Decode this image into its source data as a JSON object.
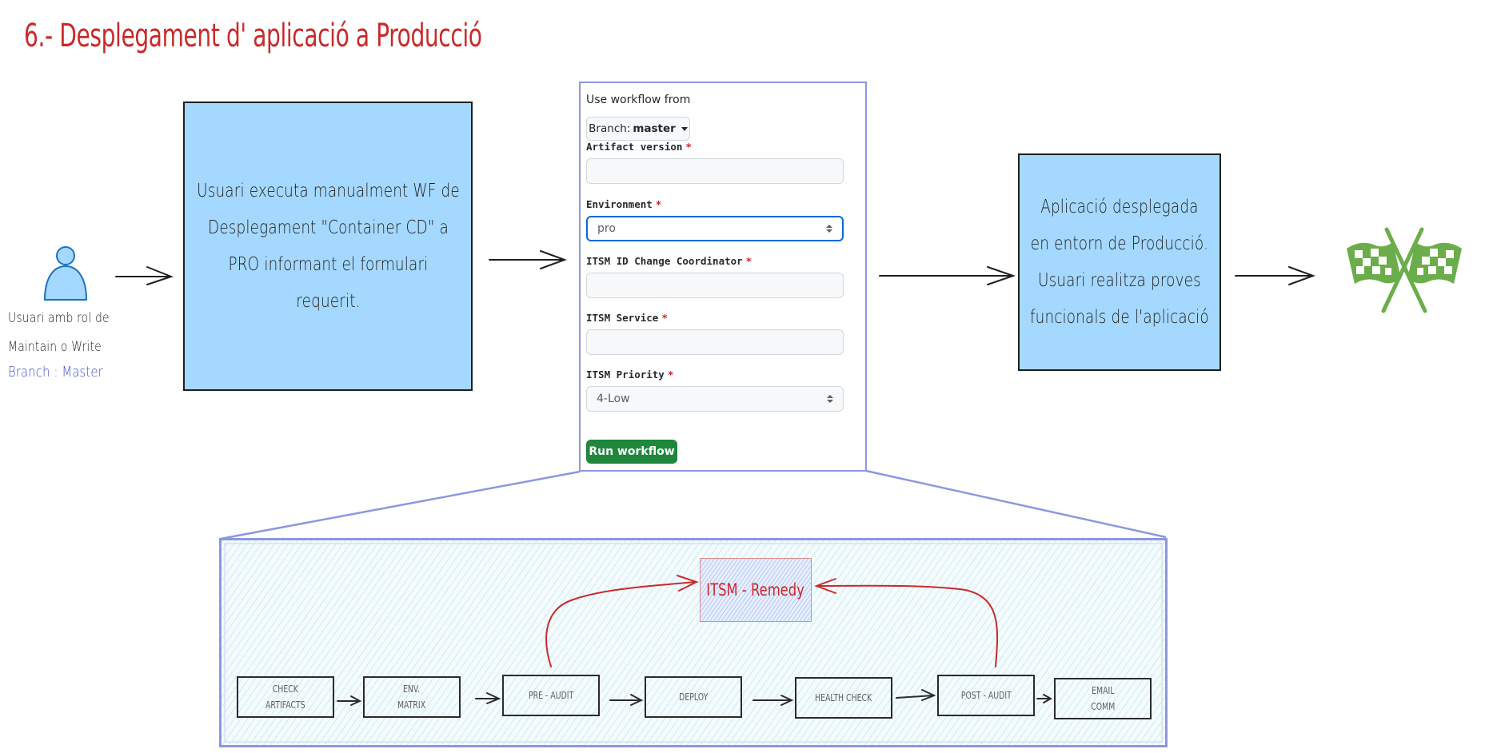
{
  "title": "6.- Desplegament d' aplicació a Producció",
  "actor": {
    "icon": "user-icon",
    "caption_lines": [
      "Usuari amb rol de",
      "Maintain o Write"
    ],
    "branch_note": "Branch : Master"
  },
  "step1": {
    "lines": [
      "Usuari executa manualment WF de",
      "Desplegament \"Container CD\" a",
      "PRO informant el formulari",
      "requerit."
    ]
  },
  "workflow_form": {
    "use_workflow_label": "Use workflow from",
    "branch_prefix": "Branch:",
    "branch_value": "master",
    "fields": [
      {
        "label": "Artifact version",
        "required_mark": "*",
        "type": "text",
        "value": ""
      },
      {
        "label": "Environment",
        "required_mark": "*",
        "type": "select",
        "value": "pro",
        "focused": true
      },
      {
        "label": "ITSM ID Change Coordinator",
        "required_mark": "*",
        "type": "text",
        "value": ""
      },
      {
        "label": "ITSM Service",
        "required_mark": "*",
        "type": "text",
        "value": ""
      },
      {
        "label": "ITSM Priority",
        "required_mark": "*",
        "type": "select",
        "value": "4-Low"
      }
    ],
    "run_button": "Run workflow"
  },
  "step2": {
    "lines": [
      "Aplicació desplegada",
      "en entorn de Producció.",
      "Usuari realitza proves",
      "funcionals de l'aplicació"
    ]
  },
  "finish_icon": "checkered-flags-icon",
  "pipeline": {
    "stages": [
      {
        "label": "CHECK\nARTIFACTS"
      },
      {
        "label": "ENV.\nMATRIX"
      },
      {
        "label": "PRE - AUDIT"
      },
      {
        "label": "DEPLOY"
      },
      {
        "label": "HEALTH CHECK"
      },
      {
        "label": "POST - AUDIT"
      },
      {
        "label": "EMAIL\nCOMM"
      }
    ],
    "itsm_box": "ITSM - Remedy"
  },
  "colors": {
    "title": "#c92a2a",
    "box_fill": "#a5d8ff",
    "frame": "#8c97e0",
    "run_button": "#1f883d",
    "flag": "#6aad4a",
    "branch_note": "#4254c4"
  }
}
